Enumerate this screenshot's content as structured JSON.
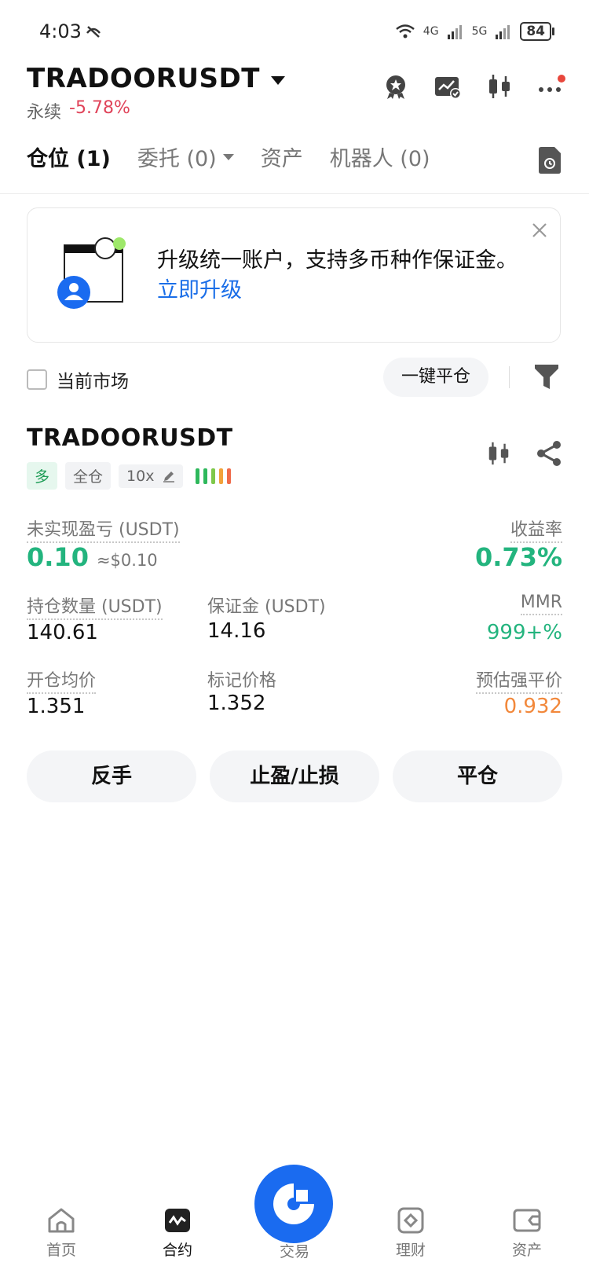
{
  "status_bar": {
    "time": "4:03",
    "net1": "4G",
    "net2": "5G",
    "battery": "84"
  },
  "header": {
    "symbol": "TRADOORUSDT",
    "contract_type": "永续",
    "change": "-5.78%"
  },
  "tabs": [
    {
      "label": "仓位 (1)"
    },
    {
      "label": "委托 (0)"
    },
    {
      "label": "资产"
    },
    {
      "label": "机器人 (0)"
    }
  ],
  "banner": {
    "text": "升级统一账户，支持多币种作保证金。",
    "link": "立即升级"
  },
  "filter": {
    "current_market_label": "当前市场",
    "close_all_label": "一键平仓"
  },
  "position": {
    "symbol": "TRADOORUSDT",
    "side_tag": "多",
    "margin_mode_tag": "全仓",
    "leverage_tag": "10x",
    "unrealized_pnl_label": "未实现盈亏 (USDT)",
    "unrealized_pnl": "0.10",
    "unrealized_pnl_usd": "≈$0.10",
    "roe_label": "收益率",
    "roe": "0.73%",
    "size_label": "持仓数量 (USDT)",
    "size": "140.61",
    "margin_label": "保证金 (USDT)",
    "margin": "14.16",
    "mmr_label": "MMR",
    "mmr": "999+%",
    "entry_label": "开仓均价",
    "entry": "1.351",
    "mark_label": "标记价格",
    "mark": "1.352",
    "liq_label": "预估强平价",
    "liq": "0.932"
  },
  "actions": {
    "reverse": "反手",
    "tpsl": "止盈/止损",
    "close": "平仓"
  },
  "bottom_nav": [
    {
      "label": "首页",
      "icon": "home-icon"
    },
    {
      "label": "合约",
      "icon": "futures-icon"
    },
    {
      "label": "交易",
      "icon": "trade-icon"
    },
    {
      "label": "理财",
      "icon": "earn-icon"
    },
    {
      "label": "资产",
      "icon": "wallet-icon"
    }
  ],
  "colors": {
    "accent": "#1a6bf0",
    "profit": "#23b47e",
    "loss": "#e0445a",
    "warning": "#f2883b"
  }
}
